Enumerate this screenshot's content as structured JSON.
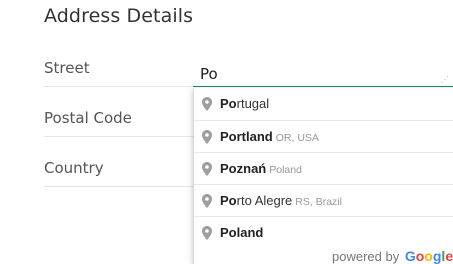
{
  "page": {
    "title": "Address Details"
  },
  "form": {
    "street_label": "Street",
    "postal_code_label": "Postal Code",
    "country_label": "Country",
    "street_value": "Po"
  },
  "autocomplete": {
    "suggestions": [
      {
        "match": "Po",
        "rest": "rtugal",
        "secondary": ""
      },
      {
        "match": "Po",
        "rest": "rtland",
        "secondary": "OR, USA"
      },
      {
        "match": "Po",
        "rest": "znań",
        "secondary": "Poland"
      },
      {
        "match": "Po",
        "rest": "rto Alegre",
        "secondary": "RS, Brazil"
      },
      {
        "match": "Po",
        "rest": "land",
        "secondary": ""
      }
    ],
    "attribution_prefix": "powered by",
    "attribution_brand": "Google",
    "pin_color": "#9e9e9e"
  },
  "colors": {
    "input_focus_underline": "#1e8f5a",
    "google_blue": "#4285f4",
    "google_red": "#ea4335",
    "google_yellow": "#fbbc05",
    "google_green": "#34a853"
  }
}
